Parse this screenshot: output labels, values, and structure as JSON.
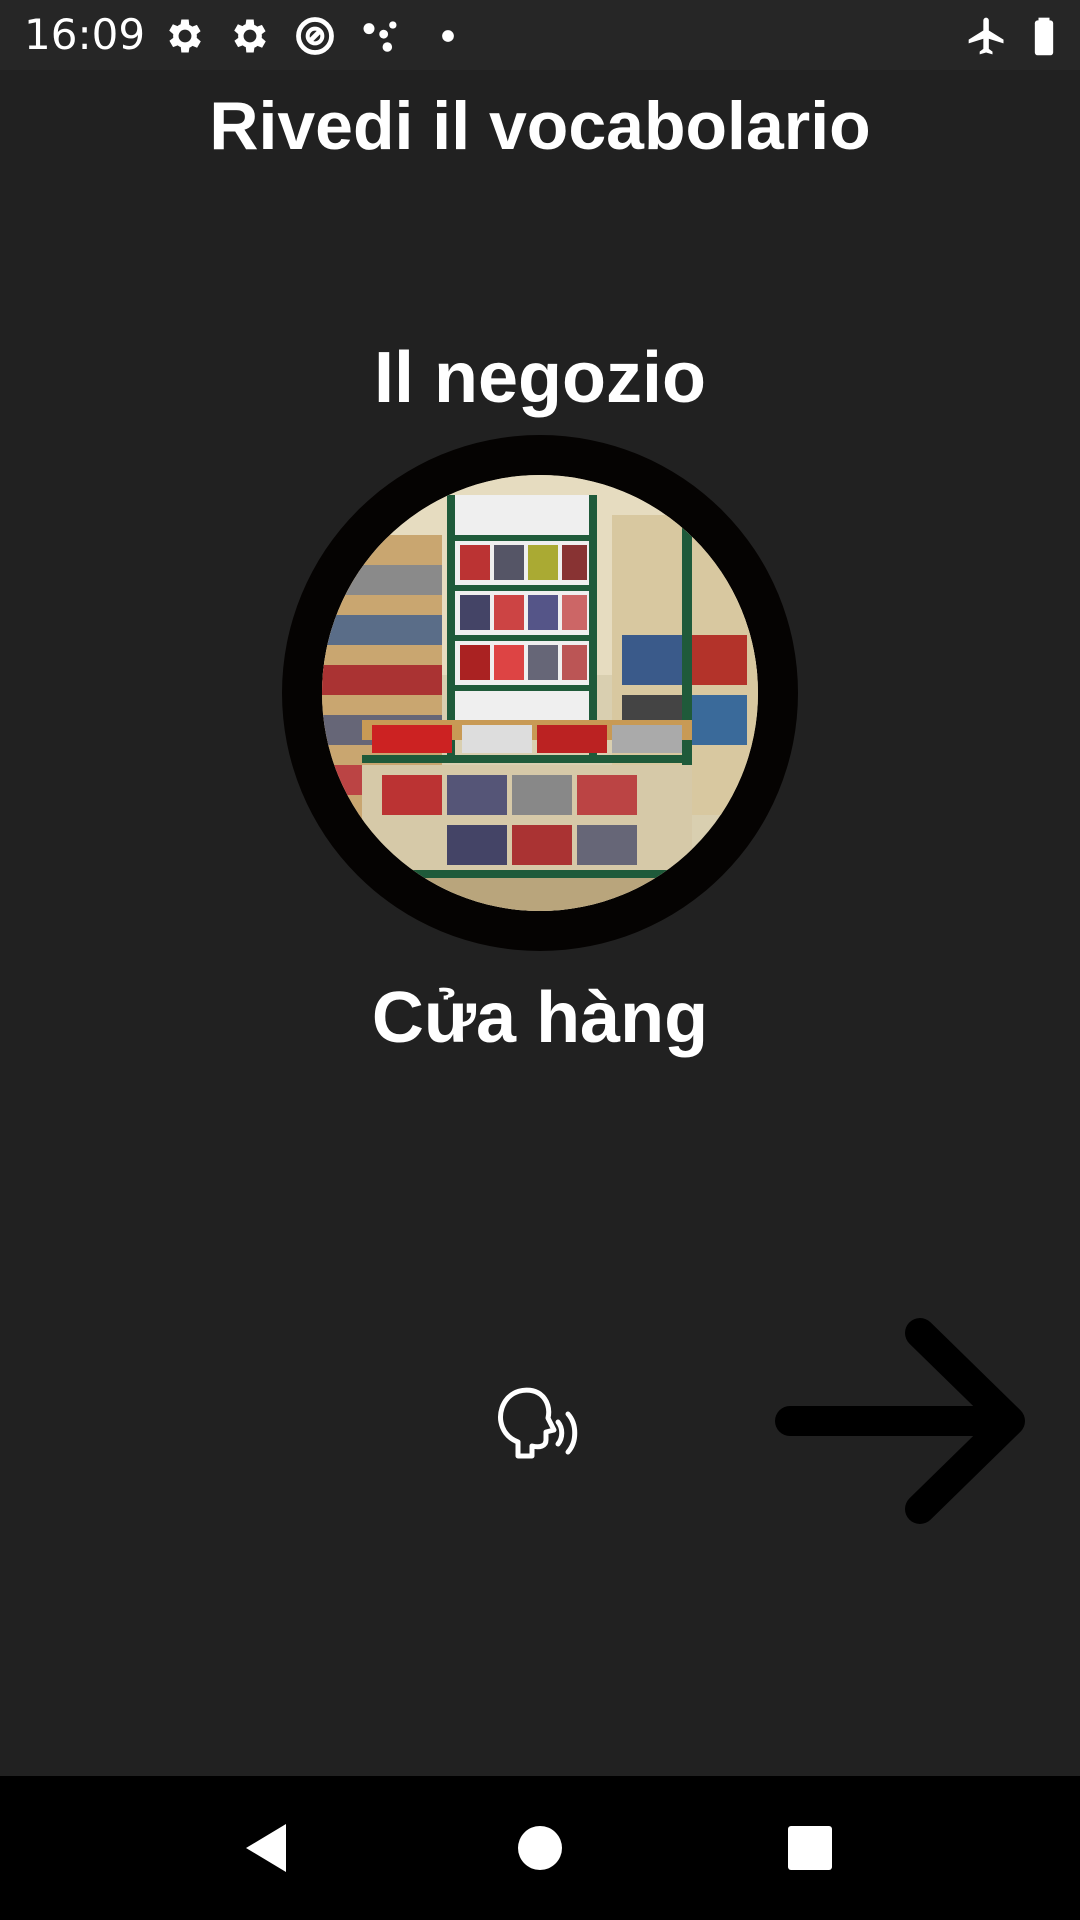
{
  "status_bar": {
    "time": "16:09",
    "icons_left": [
      "settings-icon",
      "settings-icon",
      "vpn-key-icon",
      "assistant-icon",
      "dot-icon"
    ],
    "icons_right": [
      "airplane-mode-icon",
      "battery-icon"
    ]
  },
  "header": {
    "title": "Rivedi il vocabolario"
  },
  "card": {
    "word": "Il negozio",
    "image_icon": "store-shelves-image",
    "translation": "Cửa hàng"
  },
  "controls": {
    "speak_icon": "speak-icon",
    "next_icon": "arrow-right-icon"
  },
  "nav_bar": {
    "back_icon": "back-icon",
    "home_icon": "home-icon",
    "recents_icon": "recents-icon"
  },
  "colors": {
    "background": "#212121",
    "status_bar": "#262626",
    "nav_bar": "#000000",
    "text": "#ffffff",
    "ring": "#050302"
  }
}
